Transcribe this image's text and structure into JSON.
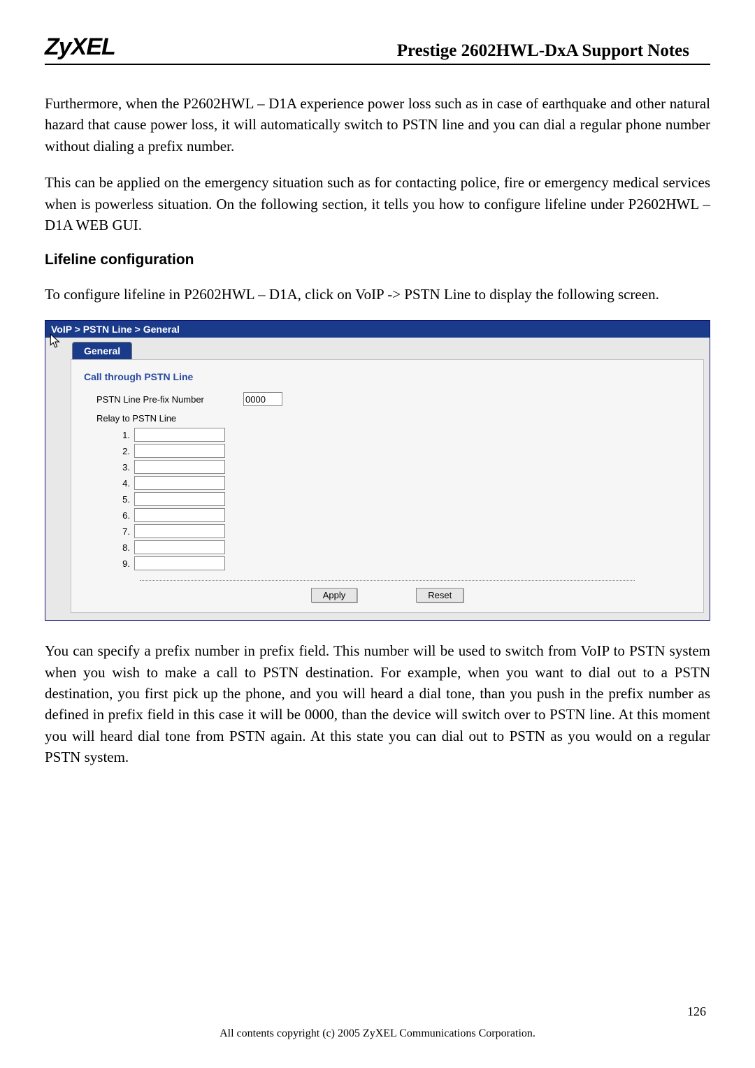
{
  "header": {
    "logo": "ZyXEL",
    "title": "Prestige 2602HWL-DxA Support Notes"
  },
  "paragraphs": {
    "p1": "Furthermore, when the P2602HWL – D1A experience power loss such as in case of earthquake and other natural hazard that cause power loss, it will automatically switch to PSTN line and you can dial a regular phone number without dialing a prefix number.",
    "p2": "This can be applied on the emergency situation such as for contacting police, fire or emergency medical services when is powerless situation. On the following section, it tells you how to configure lifeline under P2602HWL – D1A WEB GUI.",
    "heading": "Lifeline configuration",
    "p3": "To configure lifeline in P2602HWL – D1A, click on VoIP -> PSTN Line to display the following screen.",
    "p4": "You can specify a prefix number in prefix field.  This number will be used to switch from VoIP to PSTN system when you wish to make a call to PSTN destination. For example, when you want to dial out to a PSTN destination, you first pick up the phone, and you will heard a dial tone, than you push in the prefix number as defined in prefix field in this case it will be 0000, than the device will switch over to PSTN line.  At this moment you will heard dial tone from PSTN again.  At this state you can dial out to PSTN as you would on a regular PSTN system."
  },
  "gui": {
    "breadcrumb": "VoIP > PSTN Line > General",
    "tab": "General",
    "section_title": "Call through PSTN Line",
    "prefix_label": "PSTN Line Pre-fix Number",
    "prefix_value": "0000",
    "relay_label": "Relay to PSTN Line",
    "relay_numbers": [
      "1.",
      "2.",
      "3.",
      "4.",
      "5.",
      "6.",
      "7.",
      "8.",
      "9."
    ],
    "apply": "Apply",
    "reset": "Reset"
  },
  "footer": {
    "copyright": "All contents copyright (c) 2005 ZyXEL Communications Corporation.",
    "page": "126"
  }
}
